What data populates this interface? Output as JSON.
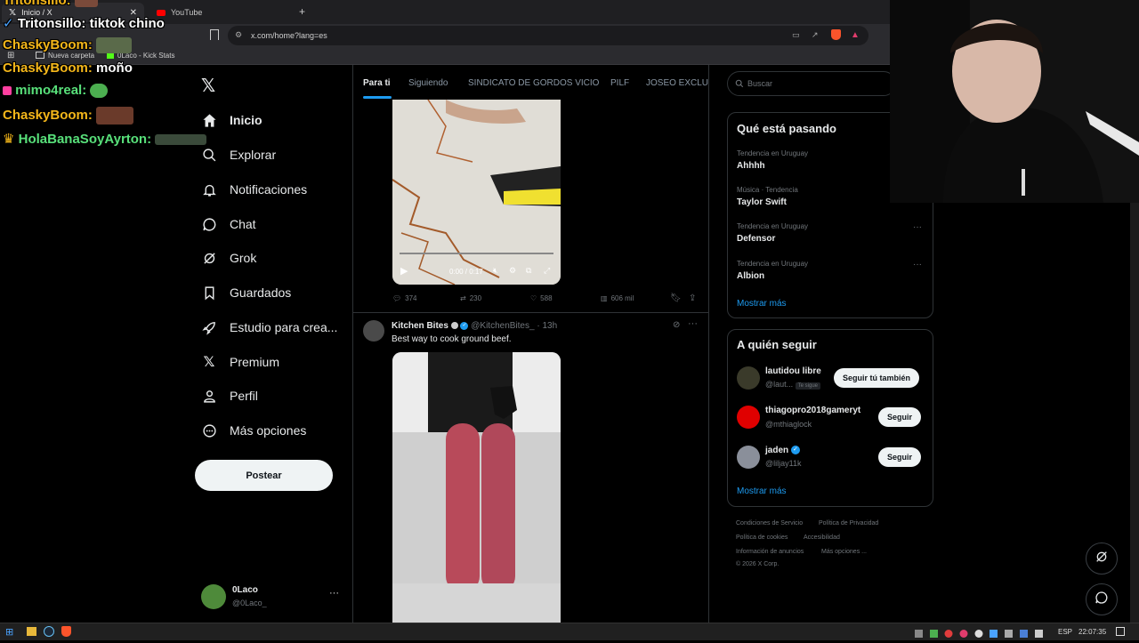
{
  "browser": {
    "tabs": [
      {
        "label": "Inicio / X",
        "icon": "x-logo-icon"
      },
      {
        "label": "YouTube",
        "icon": "youtube-icon"
      }
    ],
    "url": "x.com/home?lang=es",
    "bookmarks": [
      {
        "label": "Nueva carpeta",
        "icon": "folder-icon"
      },
      {
        "label": "0Laco - Kick Stats",
        "icon": "kick-icon"
      }
    ]
  },
  "chat_overlay": [
    {
      "user": "Tritonsillo:",
      "message": "",
      "emote": true
    },
    {
      "user": "Tritonsillo:",
      "message": "tiktok chino",
      "emote": false
    },
    {
      "user": "ChaskyBoom:",
      "message": "",
      "emote": true
    },
    {
      "user": "ChaskyBoom:",
      "message": "moño",
      "emote": false
    },
    {
      "user": "mimo4real:",
      "message": "",
      "emote": true
    },
    {
      "user": "ChaskyBoom:",
      "message": "",
      "emote": true
    },
    {
      "user": "HolaBanaSoyAyrton:",
      "message": "",
      "emote": true
    }
  ],
  "nav": {
    "items": [
      {
        "label": "Inicio",
        "icon": "home-icon",
        "active": true
      },
      {
        "label": "Explorar",
        "icon": "search-icon"
      },
      {
        "label": "Notificaciones",
        "icon": "bell-icon"
      },
      {
        "label": "Chat",
        "icon": "chat-icon"
      },
      {
        "label": "Grok",
        "icon": "grok-icon"
      },
      {
        "label": "Guardados",
        "icon": "bookmark-icon"
      },
      {
        "label": "Estudio para crea...",
        "icon": "rocket-icon"
      },
      {
        "label": "Premium",
        "icon": "x-logo-icon"
      },
      {
        "label": "Perfil",
        "icon": "person-icon"
      },
      {
        "label": "Más opciones",
        "icon": "more-circle-icon"
      }
    ],
    "post_button": "Postear",
    "account": {
      "name": "0Laco",
      "handle": "@0Laco_"
    }
  },
  "timeline": {
    "tabs": [
      "Para ti",
      "Siguiendo",
      "SINDICATO DE GORDOS VICIO",
      "PILF",
      "JOSEO EXCLUSI"
    ],
    "active_tab": 0,
    "video1": {
      "time": "0:00 / 0:17",
      "progress": 0.0
    },
    "tweet1_actions": {
      "replies": "374",
      "retweets": "230",
      "likes": "588",
      "views": "606 mil"
    },
    "tweet2": {
      "author": "Kitchen Bites",
      "handle": "@KitchenBites_",
      "time": "13h",
      "text": "Best way to cook ground beef."
    }
  },
  "right": {
    "search_placeholder": "Buscar",
    "trending": {
      "title": "Qué está pasando",
      "items": [
        {
          "meta": "Tendencia en Uruguay",
          "name": "Ahhhh"
        },
        {
          "meta": "Música · Tendencia",
          "name": "Taylor Swift"
        },
        {
          "meta": "Tendencia en Uruguay",
          "name": "Defensor"
        },
        {
          "meta": "Tendencia en Uruguay",
          "name": "Albion"
        }
      ],
      "show_more": "Mostrar más"
    },
    "who_to_follow": {
      "title": "A quién seguir",
      "items": [
        {
          "name": "lautidou libre",
          "handle": "@laut...",
          "badge": "Te sigue",
          "button": "Seguir tú también",
          "avatar_color": "#3a3a2a"
        },
        {
          "name": "thiagopro2018gameryt",
          "handle": "@mthiaglock",
          "badge": "",
          "button": "Seguir",
          "avatar_color": "#e00000"
        },
        {
          "name": "jaden",
          "handle": "@liljay11k",
          "badge": "",
          "button": "Seguir",
          "avatar_color": "#8a8f9a",
          "verified": true
        }
      ],
      "show_more": "Mostrar más"
    },
    "footer": [
      "Condiciones de Servicio",
      "Política de Privacidad",
      "Política de cookies",
      "Accesibilidad",
      "Información de anuncios",
      "Más opciones ...",
      "© 2026 X Corp."
    ]
  },
  "taskbar": {
    "lang": "ESP",
    "time": "22:07:35"
  },
  "colors": {
    "accent": "#1d9bf0",
    "bg": "#000000",
    "border": "#2f3336",
    "muted": "#71767b"
  }
}
